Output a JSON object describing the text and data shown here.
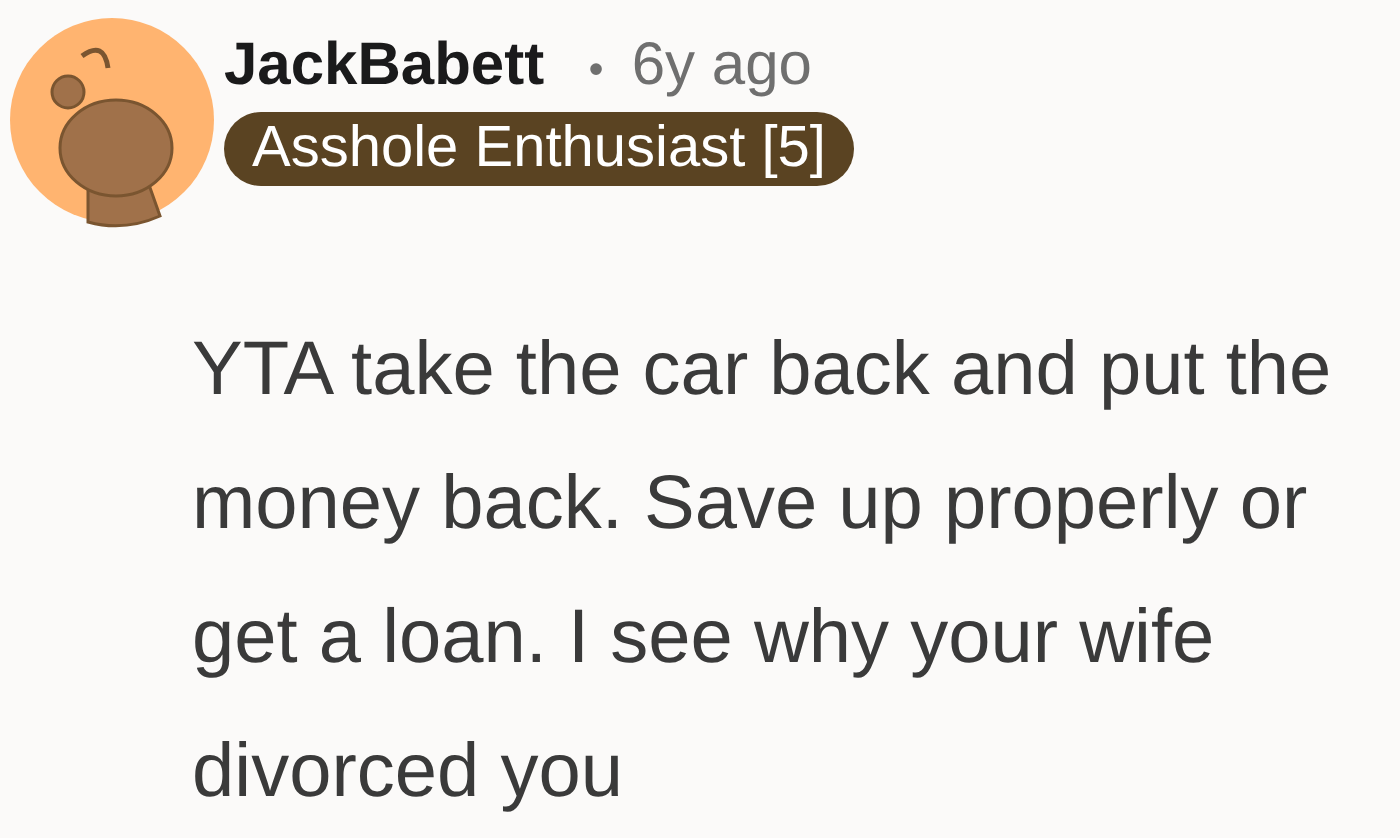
{
  "comment": {
    "author": "JackBabett",
    "separator": "•",
    "time": "6y ago",
    "flair": "Asshole Enthusiast [5]",
    "body": "YTA take the car back and put the money back. Save up properly or get a loan. I see why your wife divorced you"
  }
}
